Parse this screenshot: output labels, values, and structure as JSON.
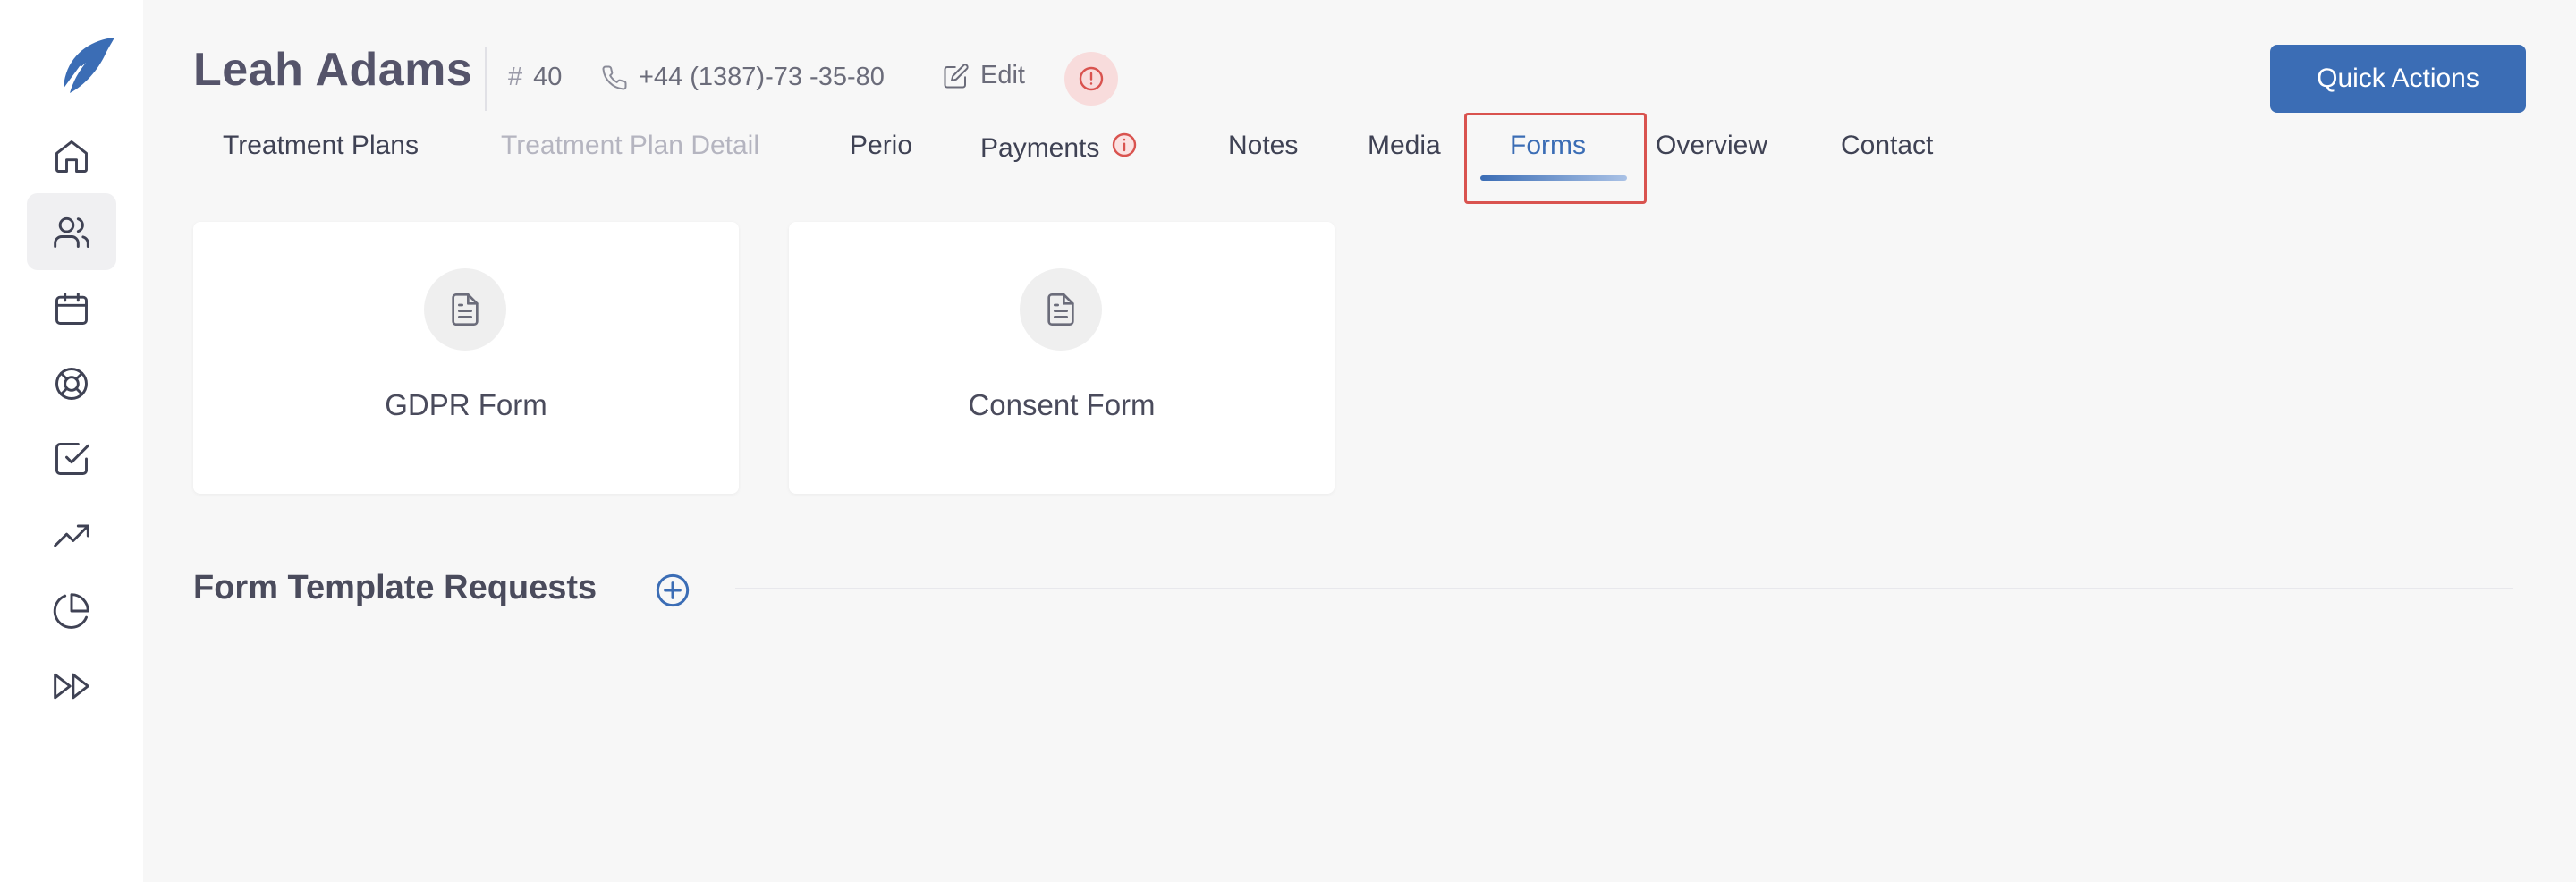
{
  "patient": {
    "name": "Leah Adams",
    "id_symbol": "#",
    "id": "40",
    "phone": "+44 (1387)-73 -35-80",
    "edit_label": "Edit"
  },
  "header": {
    "quick_actions_label": "Quick Actions"
  },
  "sidebar": {
    "items": [
      {
        "icon": "home-icon"
      },
      {
        "icon": "users-icon",
        "active": true
      },
      {
        "icon": "calendar-icon"
      },
      {
        "icon": "lifebuoy-icon"
      },
      {
        "icon": "checkbox-icon"
      },
      {
        "icon": "trending-up-icon"
      },
      {
        "icon": "pie-chart-icon"
      },
      {
        "icon": "fast-forward-icon"
      }
    ]
  },
  "tabs": [
    {
      "label": "Treatment Plans"
    },
    {
      "label": "Treatment Plan Detail",
      "disabled": true
    },
    {
      "label": "Perio"
    },
    {
      "label": "Payments",
      "has_info": true
    },
    {
      "label": "Notes"
    },
    {
      "label": "Media"
    },
    {
      "label": "Forms",
      "active": true
    },
    {
      "label": "Overview"
    },
    {
      "label": "Contact"
    }
  ],
  "forms": [
    {
      "title": "GDPR Form",
      "icon": "document-icon"
    },
    {
      "title": "Consent Form",
      "icon": "document-icon"
    }
  ],
  "section": {
    "title": "Form Template Requests"
  },
  "colors": {
    "accent": "#3b6db5",
    "alert": "#d9534f",
    "background": "#f7f7f7"
  }
}
